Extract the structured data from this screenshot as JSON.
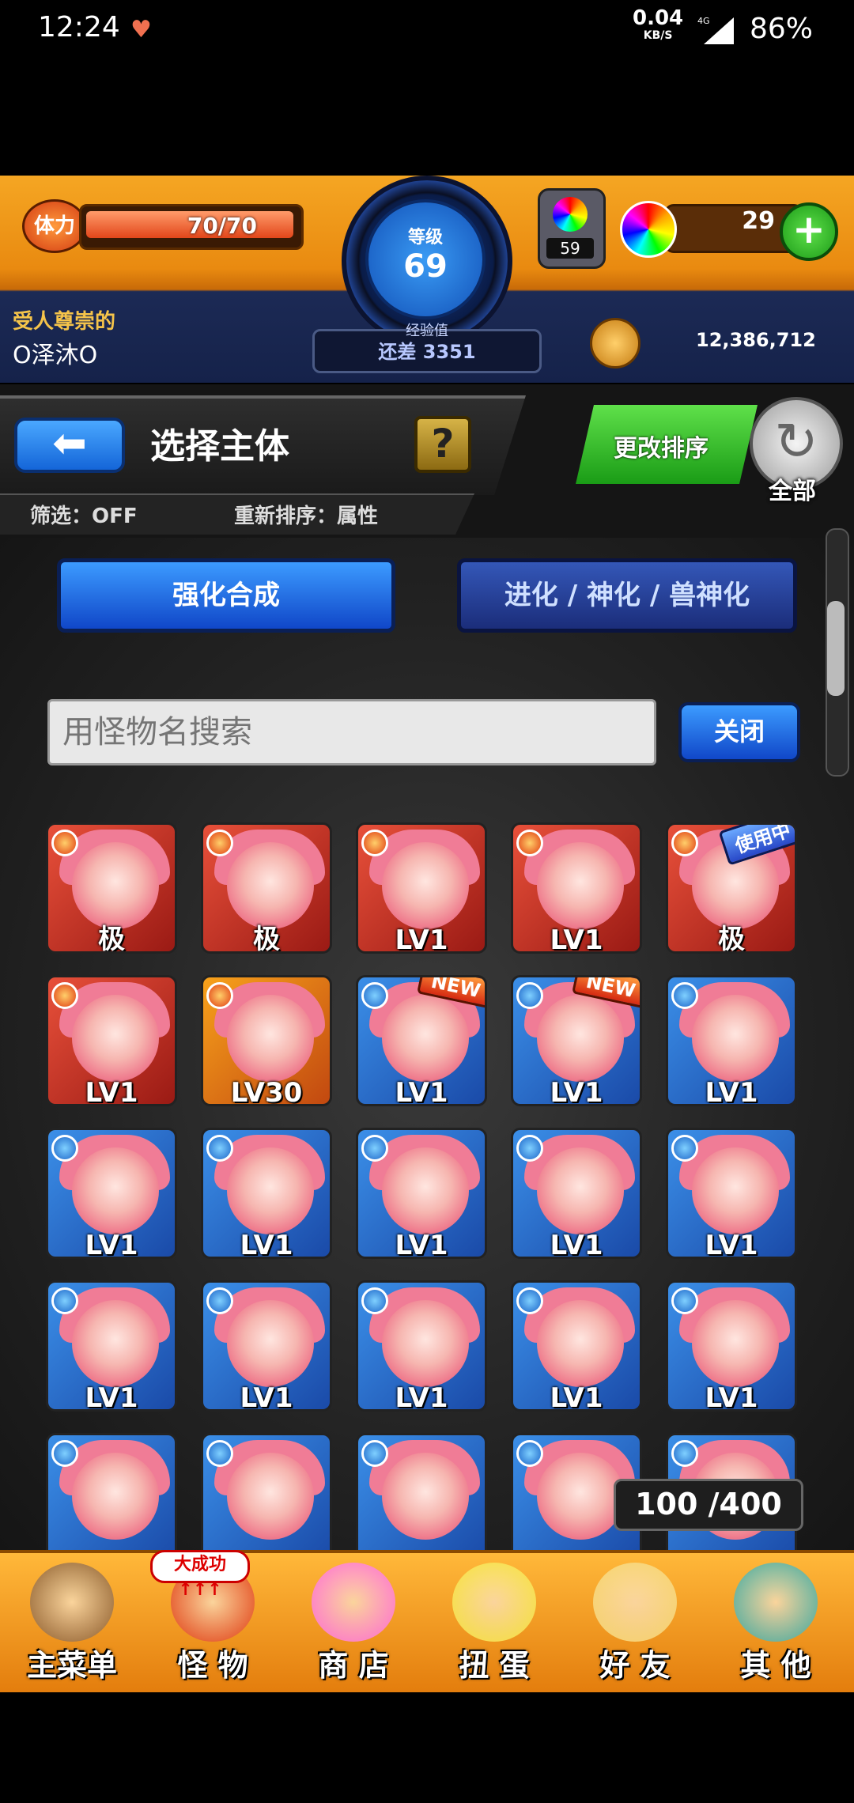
{
  "status_bar": {
    "time": "12:24",
    "speed": "0.04",
    "speed_unit": "KB/S",
    "network": "4G",
    "battery": "86%"
  },
  "header": {
    "stamina_label": "体力",
    "stamina_value": "70/70",
    "stamina_fraction": 1.0,
    "level_label": "等级",
    "level": "69",
    "exp_label": "经验值",
    "exp_text": "还差 3351",
    "lamp_count": "59",
    "orb_count": "29",
    "title": "受人尊崇的",
    "player_name": "O泽沐O",
    "gold": "12,386,712"
  },
  "subheader": {
    "page_title": "选择主体",
    "help": "?",
    "filter": "筛选：OFF",
    "resort": "重新排序：属性",
    "sort_button": "更改排序",
    "all_label": "全部"
  },
  "tabs": {
    "active": "强化合成",
    "inactive": "进化 / 神化 / 兽神化"
  },
  "search": {
    "placeholder": "用怪物名搜索",
    "close": "关闭"
  },
  "monsters": [
    {
      "level": "极",
      "bg": "red",
      "elem": "fire",
      "badge": ""
    },
    {
      "level": "极",
      "bg": "red",
      "elem": "fire",
      "badge": ""
    },
    {
      "level": "LV1",
      "bg": "red",
      "elem": "fire",
      "badge": ""
    },
    {
      "level": "LV1",
      "bg": "red",
      "elem": "fire",
      "badge": ""
    },
    {
      "level": "极",
      "bg": "red",
      "elem": "fire",
      "badge": "使用中"
    },
    {
      "level": "LV1",
      "bg": "red",
      "elem": "fire",
      "badge": ""
    },
    {
      "level": "LV30",
      "bg": "orange",
      "elem": "fire",
      "badge": ""
    },
    {
      "level": "LV1",
      "bg": "blue",
      "elem": "water",
      "badge": "NEW"
    },
    {
      "level": "LV1",
      "bg": "blue",
      "elem": "water",
      "badge": "NEW"
    },
    {
      "level": "LV1",
      "bg": "blue",
      "elem": "water",
      "badge": ""
    },
    {
      "level": "LV1",
      "bg": "blue",
      "elem": "water",
      "badge": ""
    },
    {
      "level": "LV1",
      "bg": "blue",
      "elem": "water",
      "badge": ""
    },
    {
      "level": "LV1",
      "bg": "blue",
      "elem": "water",
      "badge": ""
    },
    {
      "level": "LV1",
      "bg": "blue",
      "elem": "water",
      "badge": ""
    },
    {
      "level": "LV1",
      "bg": "blue",
      "elem": "water",
      "badge": ""
    },
    {
      "level": "LV1",
      "bg": "blue",
      "elem": "water",
      "badge": ""
    },
    {
      "level": "LV1",
      "bg": "blue",
      "elem": "water",
      "badge": ""
    },
    {
      "level": "LV1",
      "bg": "blue",
      "elem": "water",
      "badge": ""
    },
    {
      "level": "LV1",
      "bg": "blue",
      "elem": "water",
      "badge": ""
    },
    {
      "level": "LV1",
      "bg": "blue",
      "elem": "water",
      "badge": ""
    },
    {
      "level": "",
      "bg": "blue",
      "elem": "water",
      "badge": ""
    },
    {
      "level": "",
      "bg": "blue",
      "elem": "water",
      "badge": ""
    },
    {
      "level": "",
      "bg": "blue",
      "elem": "water",
      "badge": ""
    },
    {
      "level": "",
      "bg": "blue",
      "elem": "water",
      "badge": ""
    },
    {
      "level": "",
      "bg": "blue",
      "elem": "water",
      "badge": ""
    }
  ],
  "box_count": "100 /400",
  "nav": {
    "badge": "大成功↑↑↑",
    "items": [
      "主菜单",
      "怪 物",
      "商 店",
      "扭 蛋",
      "好 友",
      "其 他"
    ],
    "icon_names": [
      "castle-icon",
      "monster-icon",
      "rainbow-orb-icon",
      "egg-icon",
      "friends-icon",
      "question-icon"
    ],
    "icon_colors": [
      "#8a5a2a",
      "#e03a10",
      "#ff6ad5",
      "#f5e23a",
      "#f5d36a",
      "#3aa8a0"
    ]
  }
}
